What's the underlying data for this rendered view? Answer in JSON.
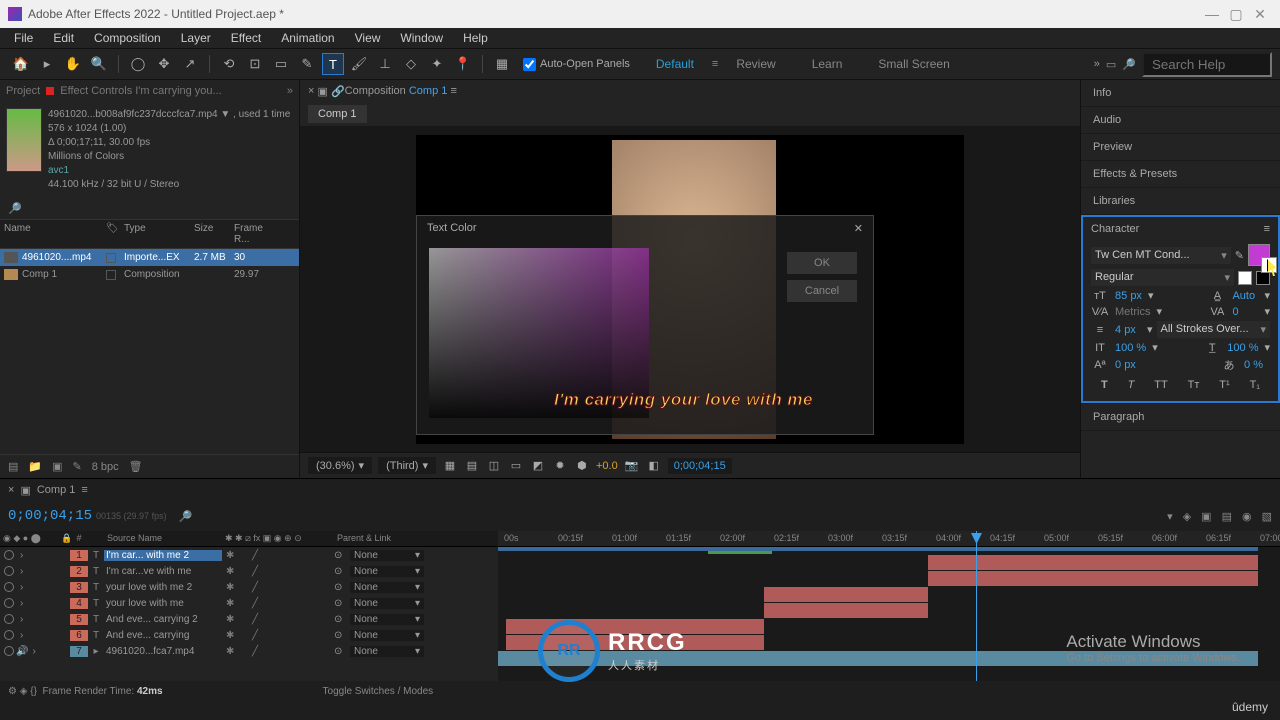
{
  "title": "Adobe After Effects 2022 - Untitled Project.aep *",
  "menu": [
    "File",
    "Edit",
    "Composition",
    "Layer",
    "Effect",
    "Animation",
    "View",
    "Window",
    "Help"
  ],
  "toolbar": {
    "auto_open": "Auto-Open Panels",
    "ws": [
      "Default",
      "Review",
      "Learn",
      "Small Screen"
    ],
    "search_ph": "Search Help"
  },
  "project": {
    "tab1": "Project",
    "tab2": "Effect Controls I'm carrying you...",
    "asset_name": "4961020...b008af9fc237dcccfca7.mp4 ▼ , used 1 time",
    "dims": "576 x 1024 (1.00)",
    "dur": "Δ 0;00;17;11, 30.00 fps",
    "colors": "Millions of Colors",
    "codec": "avc1",
    "audio": "44.100 kHz / 32 bit U / Stereo",
    "cols": {
      "name": "Name",
      "type": "Type",
      "size": "Size",
      "fr": "Frame R..."
    },
    "rows": [
      {
        "name": "4961020....mp4",
        "type": "Importe...EX",
        "size": "2.7 MB",
        "fr": "30"
      },
      {
        "name": "Comp 1",
        "type": "Composition",
        "size": "",
        "fr": "29.97"
      }
    ],
    "bpc": "8 bpc"
  },
  "comp": {
    "label": "Composition",
    "name": "Comp 1",
    "dialog_title": "Text Color",
    "dialog_ok": "OK",
    "dialog_cancel": "Cancel",
    "caption": "I'm carrying your love with me",
    "zoom": "(30.6%)",
    "res": "(Third)",
    "exp": "+0.0",
    "tc": "0;00;04;15"
  },
  "right": {
    "panels": [
      "Info",
      "Audio",
      "Preview",
      "Effects & Presets",
      "Libraries"
    ],
    "char_label": "Character",
    "font": "Tw Cen MT Cond...",
    "weight": "Regular",
    "size": "85",
    "size_u": "px",
    "lead": "Auto",
    "kern": "Metrics",
    "track": "0",
    "stroke": "4",
    "stroke_u": "px",
    "stroke_mode": "All Strokes Over...",
    "vscale": "100",
    "vscale_u": "%",
    "hscale": "100",
    "hscale_u": "%",
    "bshift": "0",
    "bshift_u": "px",
    "tsume": "0",
    "tsume_u": "%",
    "para": "Paragraph"
  },
  "timeline": {
    "comp": "Comp 1",
    "tc": "0;00;04;15",
    "frames": "00135 (29.97 fps)",
    "cols": {
      "num": "#",
      "src": "Source Name",
      "par": "Parent & Link"
    },
    "ruler": [
      "00s",
      "00:15f",
      "01:00f",
      "01:15f",
      "02:00f",
      "02:15f",
      "03:00f",
      "03:15f",
      "04:00f",
      "04:15f",
      "05:00f",
      "05:15f",
      "06:00f",
      "06:15f",
      "07:00f"
    ],
    "layers": [
      {
        "n": "1",
        "t": "T",
        "name": "I'm car... with me 2",
        "sel": true,
        "kind": "txt"
      },
      {
        "n": "2",
        "t": "T",
        "name": "I'm car...ve with me",
        "kind": "txt"
      },
      {
        "n": "3",
        "t": "T",
        "name": "your love with me 2",
        "kind": "txt"
      },
      {
        "n": "4",
        "t": "T",
        "name": "your love with me",
        "kind": "txt"
      },
      {
        "n": "5",
        "t": "T",
        "name": "And eve... carrying 2",
        "kind": "txt"
      },
      {
        "n": "6",
        "t": "T",
        "name": "And eve... carrying",
        "kind": "txt"
      },
      {
        "n": "7",
        "t": "▸",
        "name": "4961020...fca7.mp4",
        "kind": "vid"
      }
    ],
    "none": "None",
    "frt_label": "Frame Render Time:",
    "frt": "42ms",
    "toggle": "Toggle Switches / Modes"
  },
  "activate": {
    "l1": "Activate Windows",
    "l2": "Go to Settings to activate Windows."
  },
  "watermark": {
    "t": "RRCG",
    "s": "人人素材"
  },
  "udemy": "ûdemy"
}
